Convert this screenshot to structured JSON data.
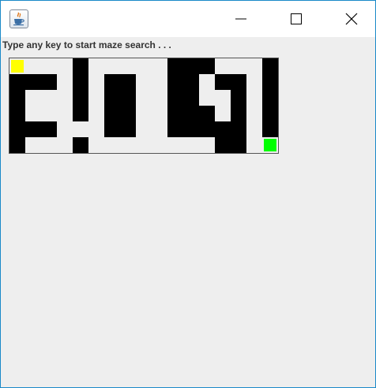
{
  "window": {
    "title": "",
    "app_icon": "java-coffee-cup-icon",
    "controls": [
      "minimize-icon",
      "maximize-icon",
      "close-icon"
    ]
  },
  "status": {
    "message": "Type any key to start maze search . . ."
  },
  "maze": {
    "rows": 6,
    "cols": 17,
    "grid": [
      "SFFFWFFFFFWWWFFFW",
      "WWWFWFWWFFWWFWWFW",
      "WFFFWFWWFFWWFFWFW",
      "WFFFWFWWFFWWWFWFW",
      "WWWFFFWWFFWWWWWFW",
      "WFFFWFFFFFFFFWWFG"
    ],
    "legend": {
      "W": "wall",
      "F": "open",
      "S": "start",
      "G": "goal"
    },
    "colors": {
      "wall": "#000000",
      "open": "#eeeeee",
      "start": "#ffff00",
      "goal": "#00ff00"
    }
  }
}
